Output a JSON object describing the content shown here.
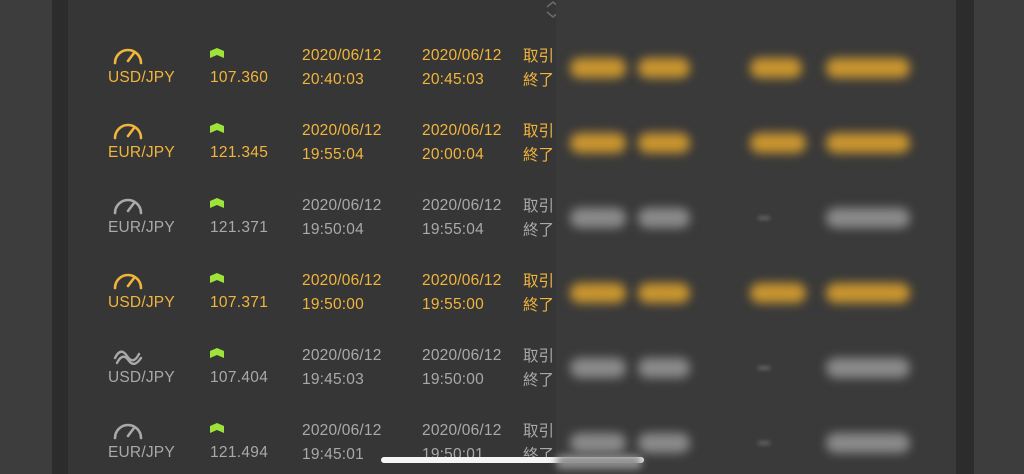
{
  "colors": {
    "active": "#f2b53b",
    "inactive": "#a9a9a9",
    "arrow_up": "#9ee33a"
  },
  "icons": {
    "sort": "sort-toggle-icon",
    "gauge": "gauge-icon",
    "wave": "wave-icon",
    "arrow": "up-arrow-icon"
  },
  "rows": [
    {
      "pair": "USD/JPY",
      "price": "107.360",
      "start_date": "2020/06/12",
      "start_time": "20:40:03",
      "end_date": "2020/06/12",
      "end_time": "20:45:03",
      "status_line1": "取引",
      "status_line2": "終了",
      "highlight": true,
      "icon": "gauge-icon"
    },
    {
      "pair": "EUR/JPY",
      "price": "121.345",
      "start_date": "2020/06/12",
      "start_time": "19:55:04",
      "end_date": "2020/06/12",
      "end_time": "20:00:04",
      "status_line1": "取引",
      "status_line2": "終了",
      "highlight": true,
      "icon": "gauge-icon"
    },
    {
      "pair": "EUR/JPY",
      "price": "121.371",
      "start_date": "2020/06/12",
      "start_time": "19:50:04",
      "end_date": "2020/06/12",
      "end_time": "19:55:04",
      "status_line1": "取引",
      "status_line2": "終了",
      "highlight": false,
      "icon": "gauge-icon"
    },
    {
      "pair": "USD/JPY",
      "price": "107.371",
      "start_date": "2020/06/12",
      "start_time": "19:50:00",
      "end_date": "2020/06/12",
      "end_time": "19:55:00",
      "status_line1": "取引",
      "status_line2": "終了",
      "highlight": true,
      "icon": "gauge-icon"
    },
    {
      "pair": "USD/JPY",
      "price": "107.404",
      "start_date": "2020/06/12",
      "start_time": "19:45:03",
      "end_date": "2020/06/12",
      "end_time": "19:50:00",
      "status_line1": "取引",
      "status_line2": "終了",
      "highlight": false,
      "icon": "wave-icon"
    },
    {
      "pair": "EUR/JPY",
      "price": "121.494",
      "start_date": "2020/06/12",
      "start_time": "19:45:01",
      "end_date": "2020/06/12",
      "end_time": "19:50:01",
      "status_line1": "取引",
      "status_line2": "終了",
      "highlight": false,
      "icon": "gauge-icon"
    }
  ]
}
